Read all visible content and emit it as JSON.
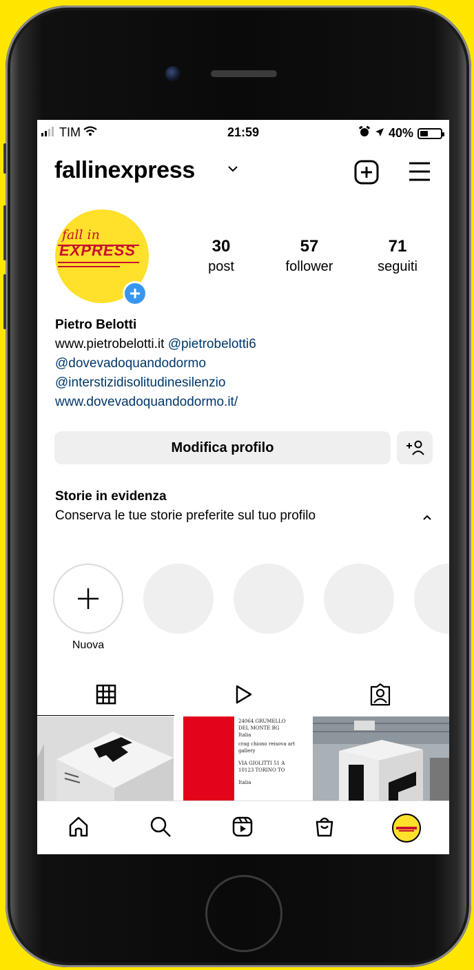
{
  "status_bar": {
    "carrier": "TIM",
    "time": "21:59",
    "battery_percent": "40%",
    "battery_level": 0.4,
    "icons": [
      "signal-icon",
      "wifi-icon",
      "alarm-icon",
      "location-icon",
      "battery-icon"
    ]
  },
  "header": {
    "username": "fallinexpress",
    "icons": [
      "chevron-down-icon",
      "new-post-icon",
      "menu-icon"
    ]
  },
  "profile": {
    "avatar_logo_small": "fall in",
    "avatar_logo_big": "EXPRESS",
    "colors": {
      "avatar_bg": "#FFE02A",
      "logo": "#C8102E",
      "plus_badge": "#3797F0"
    },
    "stats": [
      {
        "value": "30",
        "label": "post"
      },
      {
        "value": "57",
        "label": "follower"
      },
      {
        "value": "71",
        "label": "seguiti"
      }
    ],
    "bio": {
      "name": "Pietro Belotti",
      "website_text": "www.pietrobelotti.it",
      "mention_1": "@pietrobelotti6",
      "mention_2": "@dovevadoquandodormo",
      "mention_3": "@interstizidisolitudinesilenzio",
      "link": "www.dovevadoquandodormo.it/"
    },
    "edit_button": "Modifica profilo"
  },
  "highlights": {
    "title": "Storie in evidenza",
    "description": "Conserva le tue storie preferite sul tuo profilo",
    "new_label": "Nuova",
    "placeholder_count": 4
  },
  "tabs": [
    {
      "name": "grid",
      "icon": "grid-icon",
      "active": true
    },
    {
      "name": "reels",
      "icon": "reels-play-icon",
      "active": false
    },
    {
      "name": "tagged",
      "icon": "tagged-user-icon",
      "active": false
    }
  ],
  "grid_posts": {
    "post2_lines": [
      "24064 GRUMELLO",
      "DEL MONTE BG",
      "Italia",
      "crag chiono reisova art",
      "gallery",
      "VIA GIOLITTI 51 A",
      "10123 TORINO TO",
      "Italia"
    ]
  },
  "bottom_nav": [
    "home-icon",
    "search-icon",
    "reels-icon",
    "shop-icon",
    "profile-avatar"
  ]
}
